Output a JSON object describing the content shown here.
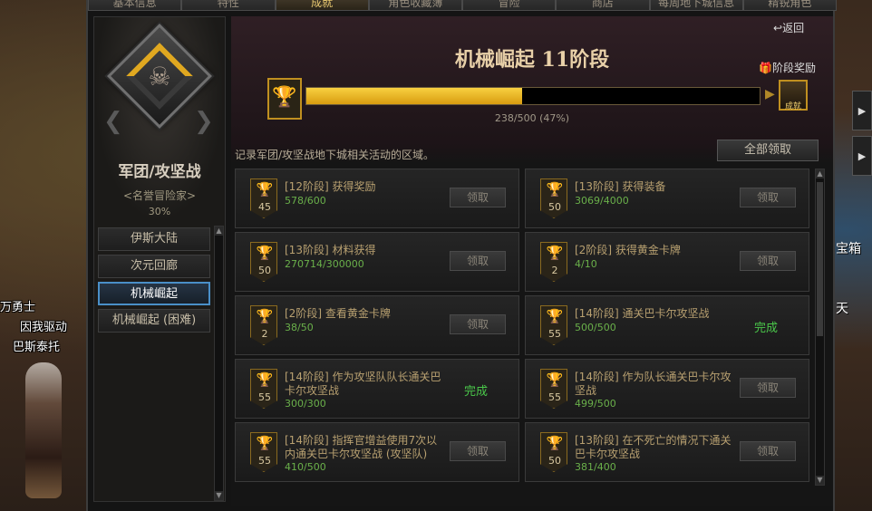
{
  "top_tabs": [
    "基本信息",
    "特性",
    "成就",
    "角色收藏簿",
    "冒险",
    "商店",
    "每周地下城信息",
    "精锐角色"
  ],
  "active_tab_index": 2,
  "left_panel": {
    "title": "军团/攻坚战",
    "subtitle": "<名誉冒险家>",
    "percent": "30%",
    "categories": [
      {
        "label": "伊斯大陆",
        "active": false
      },
      {
        "label": "次元回廊",
        "active": false
      },
      {
        "label": "机械崛起",
        "active": true
      },
      {
        "label": "机械崛起 (困难)",
        "active": false
      }
    ]
  },
  "header": {
    "back_label": "返回",
    "stage_title": "机械崛起 11阶段",
    "stage_reward_label": "阶段奖励",
    "progress_text": "238/500 (47%)",
    "progress_fraction": 0.476,
    "chest_label": "成就",
    "description": "记录军团/攻坚战地下城相关活动的区域。",
    "claim_all_label": "全部领取"
  },
  "achievements": [
    {
      "level": "45",
      "title": "[12阶段] 获得奖励",
      "progress": "578/600",
      "state": "claim"
    },
    {
      "level": "50",
      "title": "[13阶段] 获得装备",
      "progress": "3069/4000",
      "state": "claim"
    },
    {
      "level": "50",
      "title": "[13阶段] 材料获得",
      "progress": "270714/300000",
      "state": "claim"
    },
    {
      "level": "2",
      "title": "[2阶段] 获得黄金卡牌",
      "progress": "4/10",
      "state": "claim"
    },
    {
      "level": "2",
      "title": "[2阶段] 查看黄金卡牌",
      "progress": "38/50",
      "state": "claim"
    },
    {
      "level": "55",
      "title": "[14阶段] 通关巴卡尔攻坚战",
      "progress": "500/500",
      "state": "done"
    },
    {
      "level": "55",
      "title": "[14阶段] 作为攻坚队队长通关巴卡尔攻坚战",
      "progress": "300/300",
      "state": "done"
    },
    {
      "level": "55",
      "title": "[14阶段] 作为队长通关巴卡尔攻坚战",
      "progress": "499/500",
      "state": "claim"
    },
    {
      "level": "55",
      "title": "[14阶段] 指挥官增益使用7次以内通关巴卡尔攻坚战 (攻坚队)",
      "progress": "410/500",
      "state": "claim"
    },
    {
      "level": "50",
      "title": "[13阶段] 在不死亡的情况下通关巴卡尔攻坚战",
      "progress": "381/400",
      "state": "claim"
    }
  ],
  "labels": {
    "claim": "领取",
    "done": "完成"
  },
  "scene": {
    "left_char_label_1": "万勇士",
    "left_char_label_2": "巴斯泰托",
    "left_char_label_3": "因我驱动",
    "right_label_1": "宝箱",
    "right_label_2": "天"
  },
  "colors": {
    "accent_gold": "#e0a820",
    "done_green": "#4ac84a",
    "progress_green": "#6ab04a",
    "active_blue": "#4a8fc8"
  }
}
